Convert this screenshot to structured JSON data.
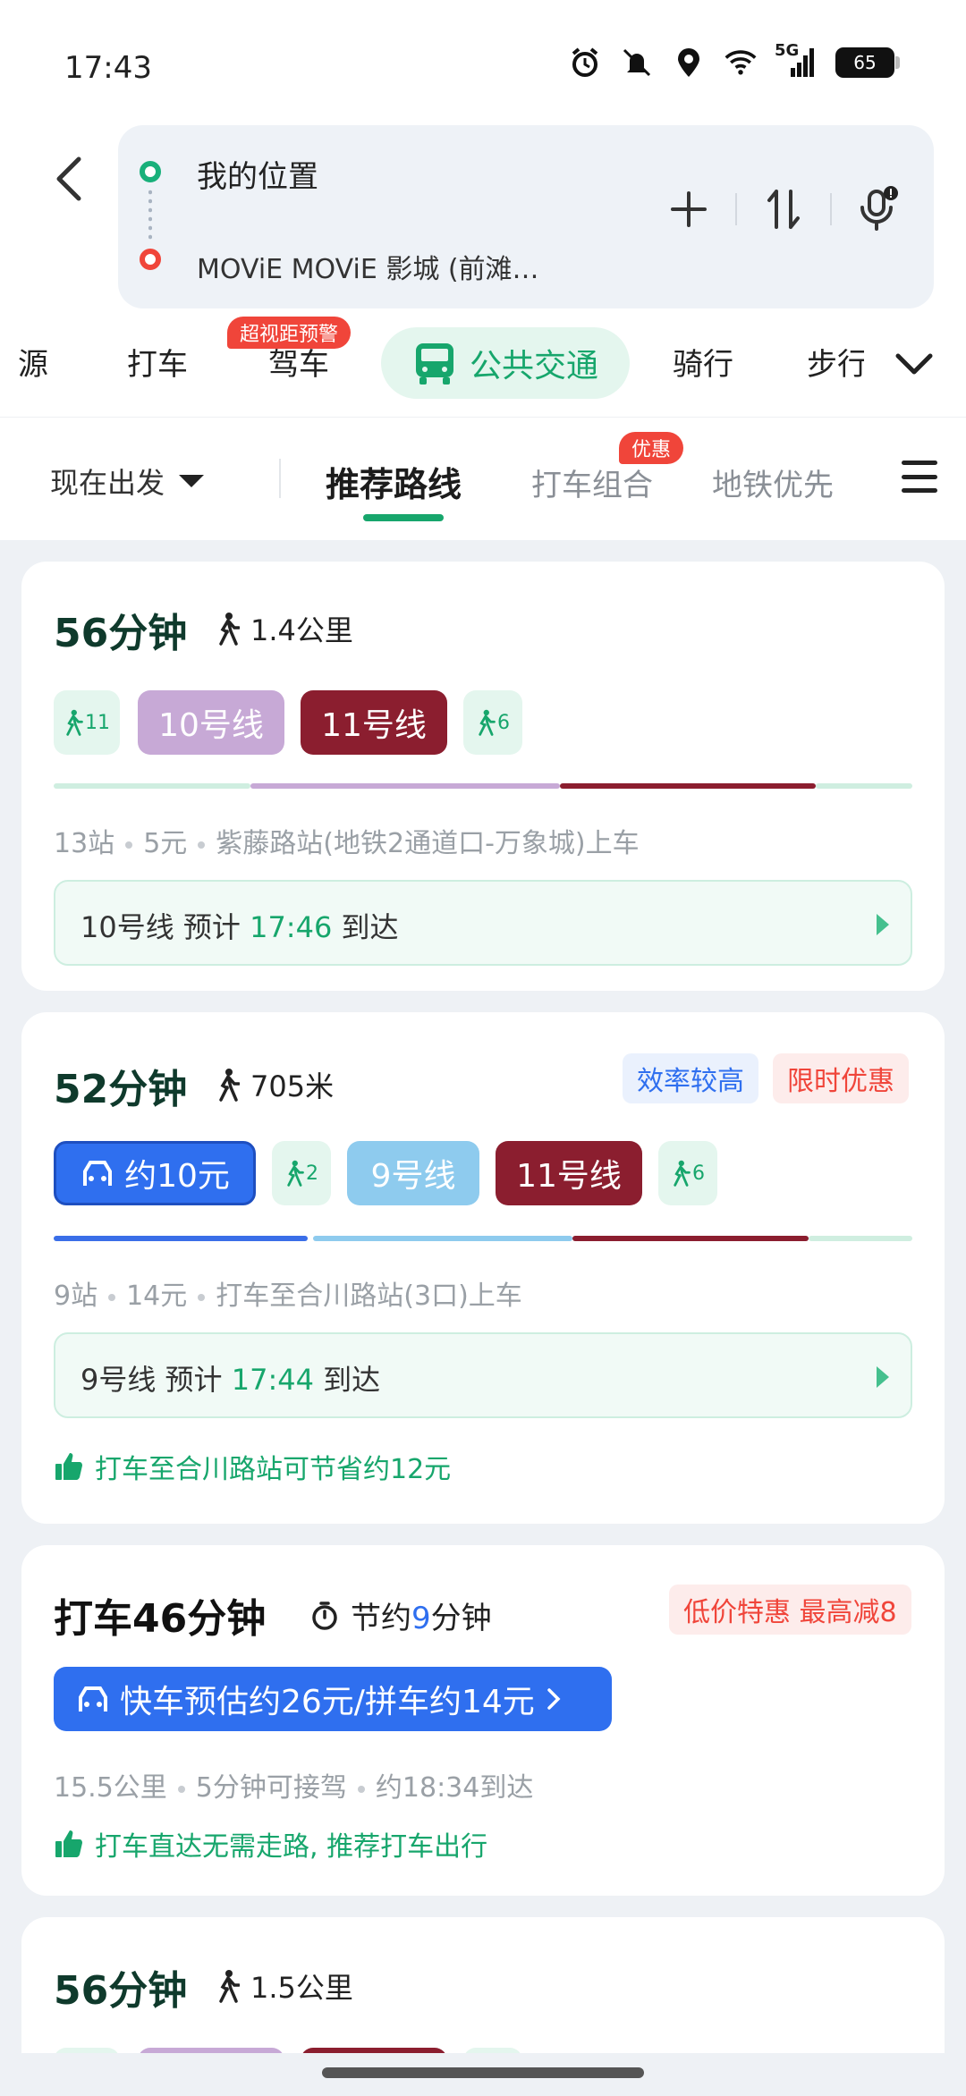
{
  "status_bar": {
    "time": "17:43",
    "network": "5G",
    "battery": "65",
    "icons": [
      "alarm-icon",
      "mute-icon",
      "location-icon",
      "wifi-icon",
      "signal-icon",
      "battery-icon"
    ]
  },
  "route": {
    "from": "我的位置",
    "to": "MOViE MOViE 影城 (前滩…",
    "actions": [
      "add-icon",
      "swap-icon",
      "voice-icon"
    ]
  },
  "modes": {
    "items": [
      "源",
      "打车",
      "驾车",
      "公共交通",
      "骑行",
      "步行"
    ],
    "active": "公共交通",
    "warn_badge": "超视距预警"
  },
  "filters": {
    "depart": "现在出发",
    "tabs": [
      "推荐路线",
      "打车组合",
      "地铁优先"
    ],
    "active": "推荐路线",
    "promo_badge": "优惠"
  },
  "colors": {
    "accent": "#17a66c",
    "line10": "#c7a9d6",
    "line11": "#8b1e2f",
    "line9": "#8ecbee",
    "taxi": "#2f6fef",
    "danger": "#f0453a"
  },
  "cards": [
    {
      "duration": "56分钟",
      "walk": "1.4公里",
      "segments": [
        {
          "type": "walk",
          "label": "11"
        },
        {
          "type": "line",
          "label": "10号线"
        },
        {
          "type": "line",
          "label": "11号线"
        },
        {
          "type": "walk",
          "label": "6"
        }
      ],
      "meta": [
        "13站",
        "5元",
        "紫藤路站(地铁2通道口-万象城)上车"
      ],
      "eta": {
        "prefix": "10号线  预计",
        "time": "17:46",
        "suffix": "到达"
      }
    },
    {
      "duration": "52分钟",
      "walk": "705米",
      "tags": [
        "效率较高",
        "限时优惠"
      ],
      "segments": [
        {
          "type": "taxi",
          "label": "约10元"
        },
        {
          "type": "walk",
          "label": "2"
        },
        {
          "type": "line",
          "label": "9号线"
        },
        {
          "type": "line",
          "label": "11号线"
        },
        {
          "type": "walk",
          "label": "6"
        }
      ],
      "meta": [
        "9站",
        "14元",
        "打车至合川路站(3口)上车"
      ],
      "eta": {
        "prefix": "9号线  预计",
        "time": "17:44",
        "suffix": "到达"
      },
      "tip": "打车至合川路站可节省约12元"
    },
    {
      "duration": "打车46分钟",
      "save_prefix": "节约",
      "save_num": "9",
      "save_suffix": "分钟",
      "tag": "低价特惠 最高减8",
      "taxi_button": "快车预估约26元/拼车约14元",
      "meta": [
        "15.5公里",
        "5分钟可接驾",
        "约18:34到达"
      ],
      "tip": "打车直达无需走路, 推荐打车出行"
    },
    {
      "duration": "56分钟",
      "walk": "1.5公里"
    }
  ]
}
